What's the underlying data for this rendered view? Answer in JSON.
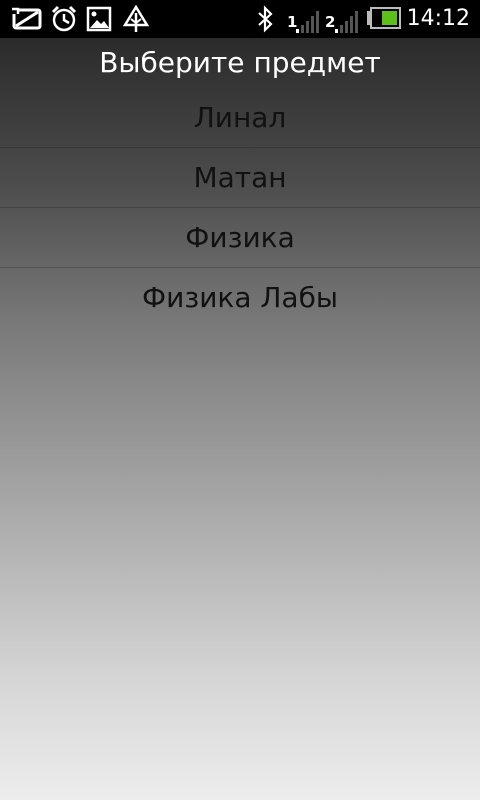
{
  "status_bar": {
    "time": "14:12",
    "sim1_label": "1",
    "sim2_label": "2",
    "icons": [
      "screenshot-icon",
      "alarm-icon",
      "gallery-icon",
      "sync-icon",
      "bluetooth-icon",
      "signal-icon",
      "battery-icon"
    ]
  },
  "screen": {
    "title": "Выберите предмет",
    "items": [
      {
        "label": "Линал"
      },
      {
        "label": "Матан"
      },
      {
        "label": "Физика"
      },
      {
        "label": "Физика Лабы"
      }
    ]
  }
}
